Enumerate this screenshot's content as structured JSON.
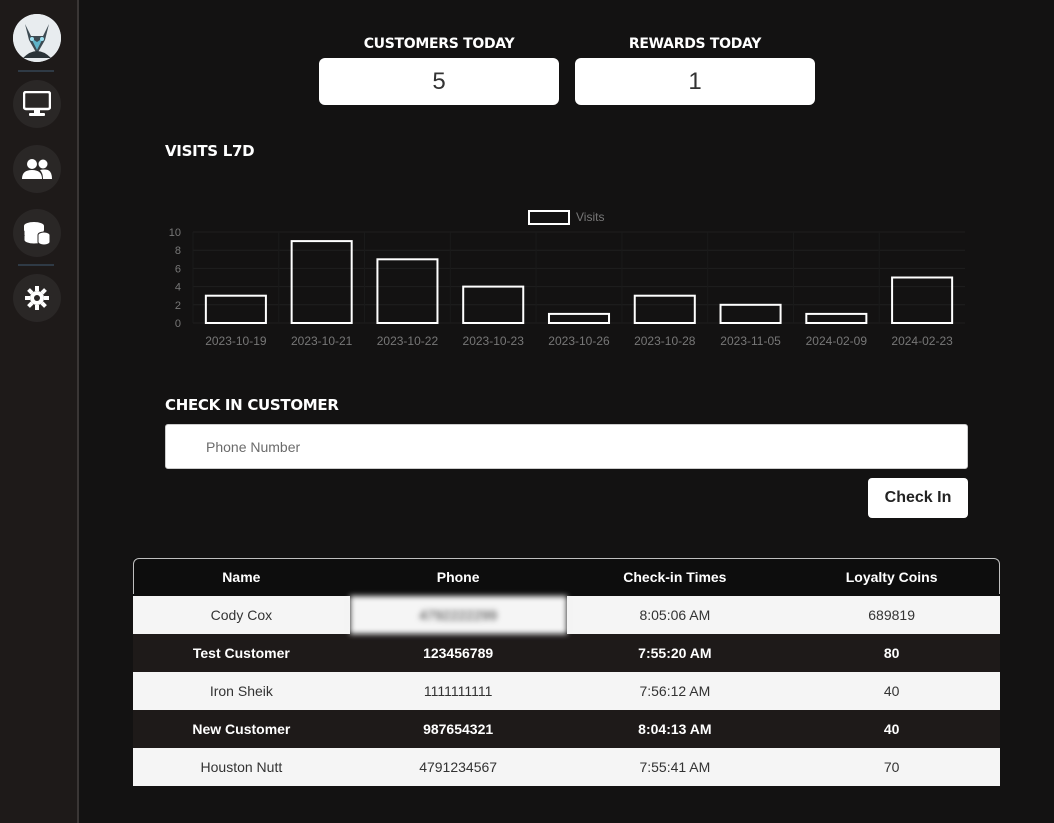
{
  "stats": {
    "customers_label": "CUSTOMERS TODAY",
    "customers_value": "5",
    "rewards_label": "REWARDS TODAY",
    "rewards_value": "1"
  },
  "sidebar": {
    "items": [
      {
        "name": "dashboard",
        "icon": "monitor-icon"
      },
      {
        "name": "customers",
        "icon": "users-icon"
      },
      {
        "name": "rewards",
        "icon": "coins-icon"
      },
      {
        "name": "settings",
        "icon": "gear-icon"
      }
    ]
  },
  "visits_title": "VISITS L7D",
  "chart_data": {
    "type": "bar",
    "legend": [
      "Visits"
    ],
    "legend_placement": "top-center",
    "categories": [
      "2023-10-19",
      "2023-10-21",
      "2023-10-22",
      "2023-10-23",
      "2023-10-26",
      "2023-10-28",
      "2023-11-05",
      "2024-02-09",
      "2024-02-23"
    ],
    "series": [
      {
        "name": "Visits",
        "values": [
          3,
          9,
          7,
          4,
          1,
          3,
          2,
          1,
          5
        ]
      }
    ],
    "ylim": [
      0,
      10
    ],
    "yticks": [
      "0",
      "2",
      "4",
      "6",
      "8",
      "10"
    ],
    "grid": true
  },
  "checkin": {
    "title": "CHECK IN CUSTOMER",
    "placeholder": "Phone Number",
    "button_label": "Check In"
  },
  "table": {
    "headers": [
      "Name",
      "Phone",
      "Check-in Times",
      "Loyalty Coins"
    ],
    "rows": [
      {
        "name": "Cody Cox",
        "phone": "4792222299",
        "time": "8:05:06 AM",
        "coins": "689819"
      },
      {
        "name": "Test Customer",
        "phone": "123456789",
        "time": "7:55:20 AM",
        "coins": "80"
      },
      {
        "name": "Iron Sheik",
        "phone": "1111111111",
        "time": "7:56:12 AM",
        "coins": "40"
      },
      {
        "name": "New Customer",
        "phone": "987654321",
        "time": "8:04:13 AM",
        "coins": "40"
      },
      {
        "name": "Houston Nutt",
        "phone": "4791234567",
        "time": "7:55:41 AM",
        "coins": "70"
      }
    ]
  },
  "colors": {
    "background": "#131212",
    "sidebar": "#1e1a19",
    "card": "#ffffff",
    "bar_stroke": "#ffffff"
  }
}
